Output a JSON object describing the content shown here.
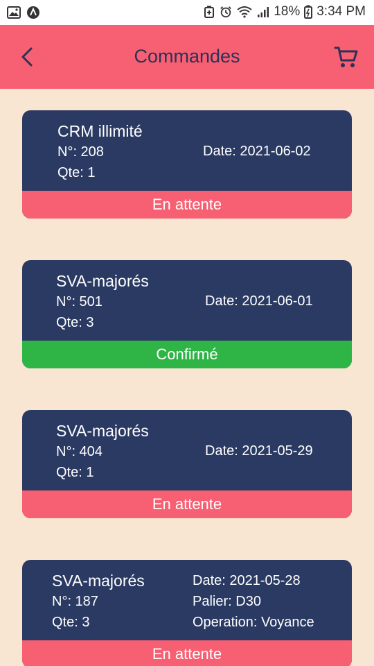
{
  "status_bar": {
    "battery": "18%",
    "time": "3:34 PM",
    "left_icons": [
      "image-icon",
      "app-notification-icon"
    ],
    "right_icons": [
      "battery-saver-icon",
      "alarm-icon",
      "wifi-icon",
      "signal-icon",
      "battery-icon"
    ]
  },
  "header": {
    "title": "Commandes",
    "back_icon": "chevron-left-icon",
    "cart_icon": "cart-icon",
    "background": "#f75f72"
  },
  "colors": {
    "page_bg": "#f8e6d3",
    "card_bg": "#2b3a63",
    "pending": "#f75f72",
    "confirmed": "#2eb546"
  },
  "orders": [
    {
      "name": "CRM illimité",
      "number": "N°: 208",
      "qty": "Qte: 1",
      "date": "Date: 2021-06-02",
      "status": "En attente"
    },
    {
      "name": "SVA-majorés",
      "number": "N°: 501",
      "qty": "Qte: 3",
      "date": "Date: 2021-06-01",
      "status": "Confirmé"
    },
    {
      "name": "SVA-majorés",
      "number": "N°: 404",
      "qty": "Qte: 1",
      "date": "Date: 2021-05-29",
      "status": "En attente"
    },
    {
      "name": "SVA-majorés",
      "number": "N°: 187",
      "qty": "Qte: 3",
      "date": "Date: 2021-05-28",
      "palier": "Palier: D30",
      "operation": "Operation: Voyance",
      "status": "En attente"
    }
  ]
}
